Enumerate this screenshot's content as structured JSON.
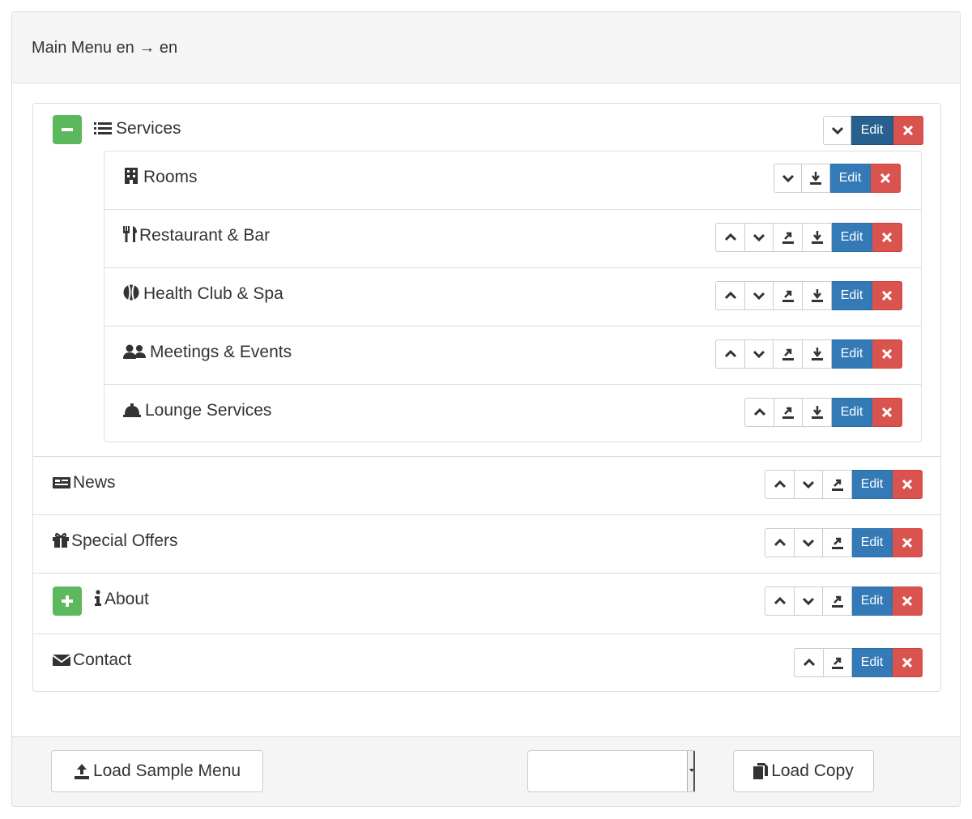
{
  "header": {
    "title_pre": "Main Menu en",
    "arrow": "→",
    "title_post": "en"
  },
  "menu": {
    "services": {
      "label": "Services",
      "icon": "list-icon",
      "toggle": "collapse",
      "edit_label": "Edit",
      "children": [
        {
          "label": "Rooms",
          "icon": "building-icon"
        },
        {
          "label": "Restaurant & Bar",
          "icon": "cutlery-icon"
        },
        {
          "label": "Health Club & Spa",
          "icon": "spa-icon"
        },
        {
          "label": "Meetings & Events",
          "icon": "users-icon"
        },
        {
          "label": "Lounge Services",
          "icon": "bell-icon"
        }
      ]
    },
    "items": [
      {
        "label": "News",
        "icon": "newspaper-icon"
      },
      {
        "label": "Special Offers",
        "icon": "gift-icon"
      },
      {
        "label": "About",
        "icon": "info-icon",
        "toggle": "expand"
      },
      {
        "label": "Contact",
        "icon": "envelope-icon"
      }
    ],
    "edit_label": "Edit"
  },
  "footer": {
    "load_sample_label": "Load Sample Menu",
    "select_value": "",
    "load_copy_label": "Load Copy"
  },
  "colors": {
    "edit": "#337ab7",
    "delete": "#d9534f",
    "toggle": "#5cb85c"
  }
}
